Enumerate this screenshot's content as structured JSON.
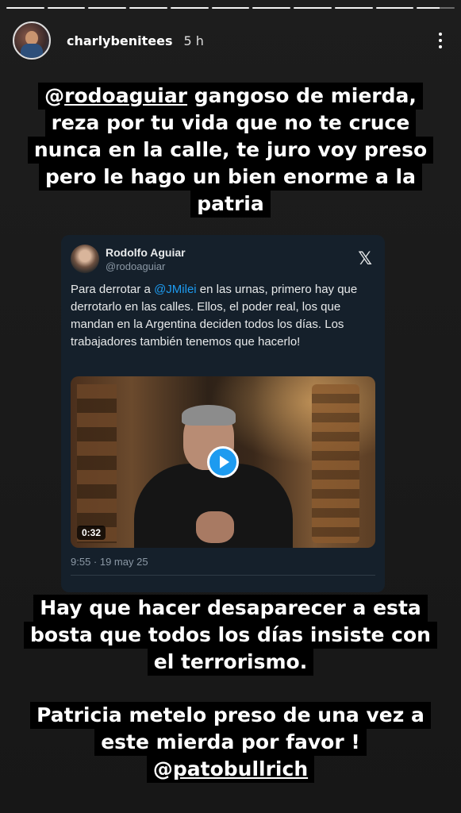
{
  "story": {
    "username": "charlybenitees",
    "time": "5 h",
    "progress_segments": 11,
    "icons": {
      "more": "more-vertical-icon",
      "threads": "threads-icon"
    }
  },
  "caption_top": {
    "mention": "rodoaguiar",
    "line1_rest": " gangoso de mierda,",
    "line2": "reza por tu vida que no te cruce",
    "line3": "nunca en la calle, te juro voy preso",
    "line4": "pero le hago un bien enorme a la",
    "line5": "patria"
  },
  "tweet": {
    "name": "Rodolfo Aguiar",
    "handle": "@rodoaguiar",
    "text_before": "Para derrotar a ",
    "text_tag": "@JMilei",
    "text_after": " en las urnas, primero hay que derrotarlo en las calles. Ellos, el poder real, los que mandan en la Argentina deciden todos los días. Los trabajadores también tenemos que hacerlo!",
    "video_duration": "0:32",
    "timestamp": "9:55 · 19 may 25",
    "x_logo": "𝕏",
    "colors": {
      "bg": "#15202b",
      "link": "#1d9bf0"
    }
  },
  "caption_mid": {
    "line1": "Hay que hacer desaparecer a esta",
    "line2": "bosta que todos los días insiste con",
    "line3": "el terrorismo."
  },
  "caption_bottom": {
    "line1": "Patricia metelo preso de una vez a",
    "line2": "este mierda por favor !",
    "mention": "patobullrich"
  }
}
